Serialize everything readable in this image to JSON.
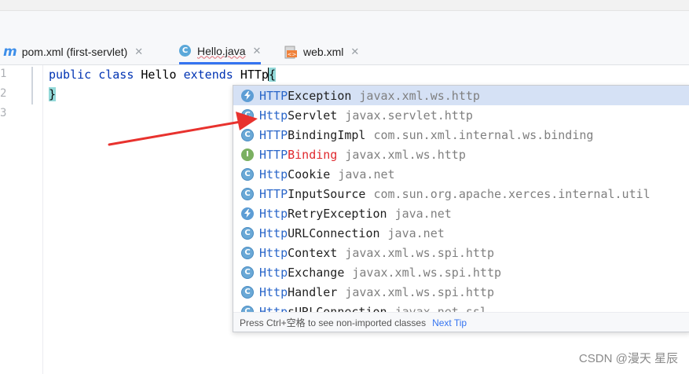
{
  "tabs": [
    {
      "icon": "maven-icon",
      "label": "pom.xml (first-servlet)",
      "active": false
    },
    {
      "icon": "java-class-icon",
      "label": "Hello.java",
      "active": true
    },
    {
      "icon": "xml-file-icon",
      "label": "web.xml",
      "active": false
    }
  ],
  "editor": {
    "line_numbers": [
      "1",
      "2",
      "3"
    ],
    "line1": {
      "kw1": "public",
      "kw2": "class",
      "name": "Hello",
      "kw3": "extends",
      "typed_before_caret": "HTTp",
      "brace": "{"
    },
    "line2": {
      "brace": "}"
    }
  },
  "completion": {
    "items": [
      {
        "icon": "exception-icon",
        "match": "HTTP",
        "rest": "Exception",
        "package": "javax.xml.ws.http",
        "selected": true
      },
      {
        "icon": "class-icon",
        "match": "Http",
        "rest": "Servlet",
        "package": "javax.servlet.http"
      },
      {
        "icon": "class-icon",
        "match": "HTTP",
        "rest": "BindingImpl",
        "package": "com.sun.xml.internal.ws.binding"
      },
      {
        "icon": "interface-icon",
        "match": "HTTP",
        "rest": "Binding",
        "package": "javax.xml.ws.http",
        "error": true
      },
      {
        "icon": "class-icon",
        "match": "Http",
        "rest": "Cookie",
        "package": "java.net"
      },
      {
        "icon": "class-icon",
        "match": "HTTP",
        "rest": "InputSource",
        "package": "com.sun.org.apache.xerces.internal.util"
      },
      {
        "icon": "exception-icon",
        "match": "Http",
        "rest": "RetryException",
        "package": "java.net"
      },
      {
        "icon": "class-icon",
        "match": "Http",
        "rest": "URLConnection",
        "package": "java.net"
      },
      {
        "icon": "class-icon",
        "match": "Http",
        "rest": "Context",
        "package": "javax.xml.ws.spi.http"
      },
      {
        "icon": "class-icon",
        "match": "Http",
        "rest": "Exchange",
        "package": "javax.xml.ws.spi.http"
      },
      {
        "icon": "class-icon",
        "match": "Http",
        "rest": "Handler",
        "package": "javax.xml.ws.spi.http"
      },
      {
        "icon": "class-icon",
        "match": "Http",
        "rest": "sURLConnection",
        "package": "javax.net.ssl"
      }
    ],
    "hint_text": "Press Ctrl+空格 to see non-imported classes",
    "next_tip": "Next Tip"
  },
  "colors": {
    "accent": "#3574f0",
    "match": "#2a66c9",
    "error": "#e0292e",
    "arrow": "#e8322e"
  },
  "watermark": "CSDN @漫天 星辰"
}
